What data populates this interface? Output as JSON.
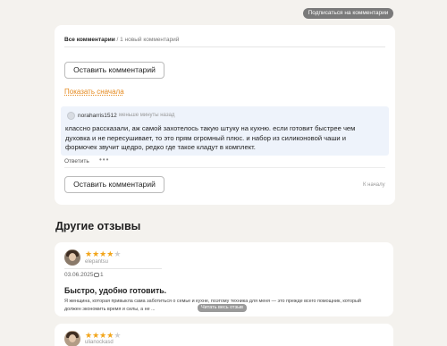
{
  "subscribe_button": "Подписаться на комментарии",
  "comments": {
    "tab_all": "Все комментарии",
    "tab_new": "/ 1 новый комментарий",
    "leave_comment": "Оставить комментарий",
    "show_first": "Показать сначала",
    "reply": "Ответить",
    "more": "•••",
    "to_top": "К началу",
    "item": {
      "author": "noraharris1512",
      "time": "меньше минуты назад",
      "text": "классно рассказали, аж самой захотелось такую штуку на кухню. если готовит быстрее чем духовка и не пересушивает, то это прям огромный плюс. и набор из силиконовой чаши и формочек звучит щедро, редко где такое кладут в комплект."
    }
  },
  "other_reviews": {
    "heading": "Другие отзывы",
    "items": [
      {
        "author": "elepantsu",
        "rating": 4,
        "rating_max": 5,
        "date": "03.06.2025",
        "comments_count": "1",
        "title": "Быстро, удобно готовить.",
        "excerpt": "Я женщина, которая привыкла сама заботиться о семье и кухне, поэтому техника для меня — это прежде всего помощник, который должен экономить время и силы, а не ...",
        "read_full": "Читать весь отзыв"
      },
      {
        "author": "ulianockasd",
        "rating": 4,
        "rating_max": 5
      }
    ]
  },
  "colors": {
    "background": "#f4f2ee",
    "accent_link": "#e58a1f",
    "star": "#f2a51a",
    "comment_bg": "#eef3fb"
  }
}
